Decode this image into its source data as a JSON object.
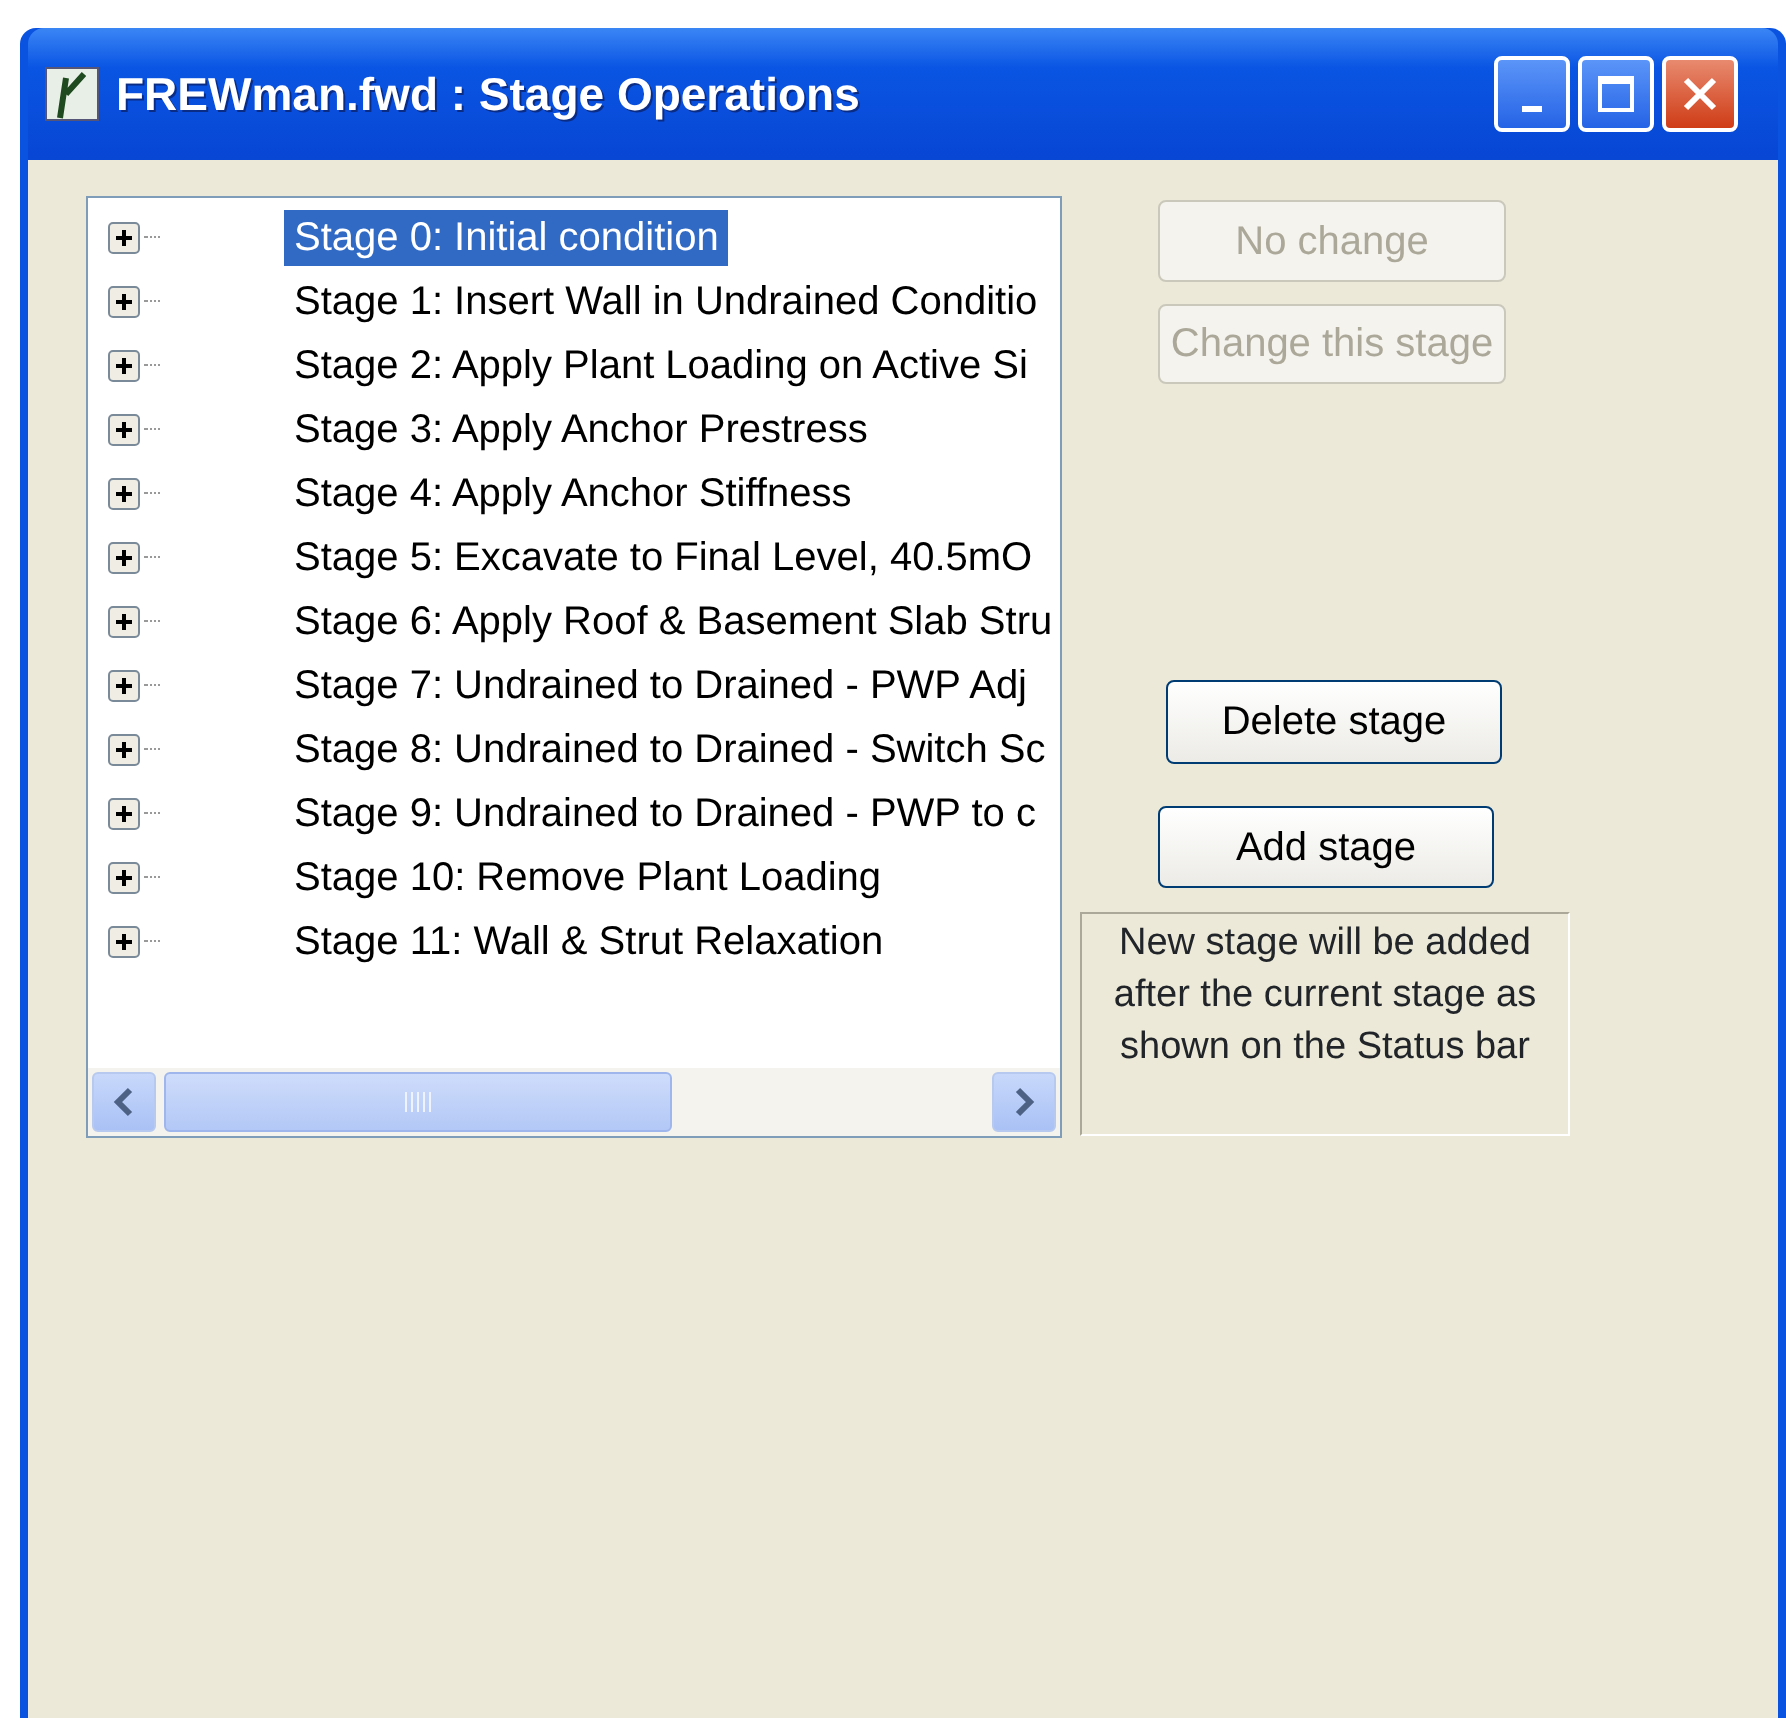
{
  "window": {
    "title": "FREWman.fwd : Stage Operations"
  },
  "stages": [
    {
      "label": "Stage 0: Initial condition",
      "selected": true
    },
    {
      "label": "Stage 1: Insert Wall in Undrained Conditio",
      "selected": false
    },
    {
      "label": "Stage 2: Apply Plant Loading on Active Si",
      "selected": false
    },
    {
      "label": "Stage 3: Apply Anchor Prestress",
      "selected": false
    },
    {
      "label": "Stage 4: Apply Anchor Stiffness",
      "selected": false
    },
    {
      "label": "Stage 5: Excavate to Final Level, 40.5mO",
      "selected": false
    },
    {
      "label": "Stage 6: Apply Roof & Basement Slab Stru",
      "selected": false
    },
    {
      "label": "Stage 7: Undrained to Drained - PWP Adj",
      "selected": false
    },
    {
      "label": "Stage 8: Undrained to Drained - Switch Sc",
      "selected": false
    },
    {
      "label": "Stage 9: Undrained to Drained - PWP to c",
      "selected": false
    },
    {
      "label": "Stage 10: Remove Plant Loading",
      "selected": false
    },
    {
      "label": "Stage 11: Wall & Strut Relaxation",
      "selected": false
    }
  ],
  "buttons": [
    {
      "label": "No change",
      "disabled": true
    },
    {
      "label": "Change this stage",
      "disabled": true
    },
    {
      "label": "Delete stage",
      "disabled": false
    },
    {
      "label": "Add stage",
      "disabled": false
    }
  ],
  "note": "New stage will be added after the current stage as shown on the Status bar"
}
